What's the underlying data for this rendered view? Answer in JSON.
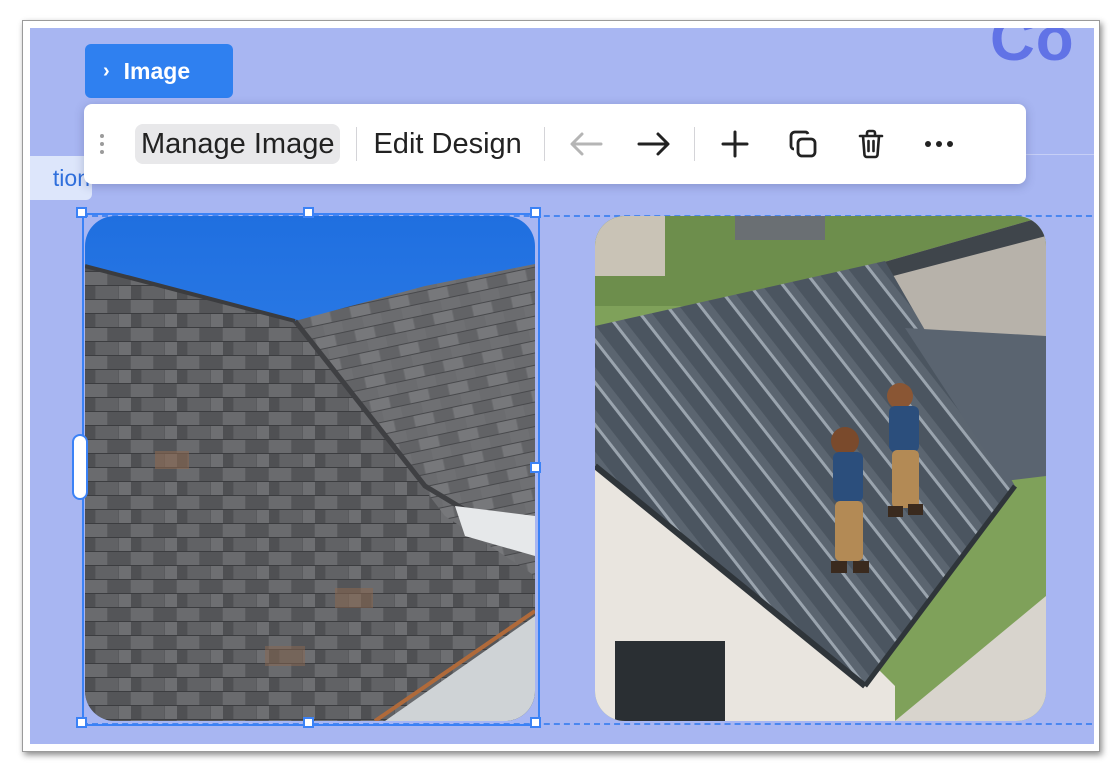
{
  "page": {
    "heading_fragment": "Co",
    "section_tag": "tion"
  },
  "element_chip": {
    "label": "Image",
    "chevron": "chevron-right-icon"
  },
  "toolbar": {
    "manage_image_label": "Manage Image",
    "edit_design_label": "Edit Design",
    "icons": [
      "drag-handle-icon",
      "arrow-left-icon",
      "arrow-right-icon",
      "plus-icon",
      "duplicate-icon",
      "trash-icon",
      "more-icon"
    ]
  },
  "images": [
    {
      "name": "shingle-roof-photo",
      "selected": true
    },
    {
      "name": "metal-roof-workers-photo",
      "selected": false
    }
  ],
  "colors": {
    "canvas_bg": "#a8b6f2",
    "accent": "#2f80f0",
    "selection": "#3b82f6",
    "heading": "#6173e6"
  }
}
